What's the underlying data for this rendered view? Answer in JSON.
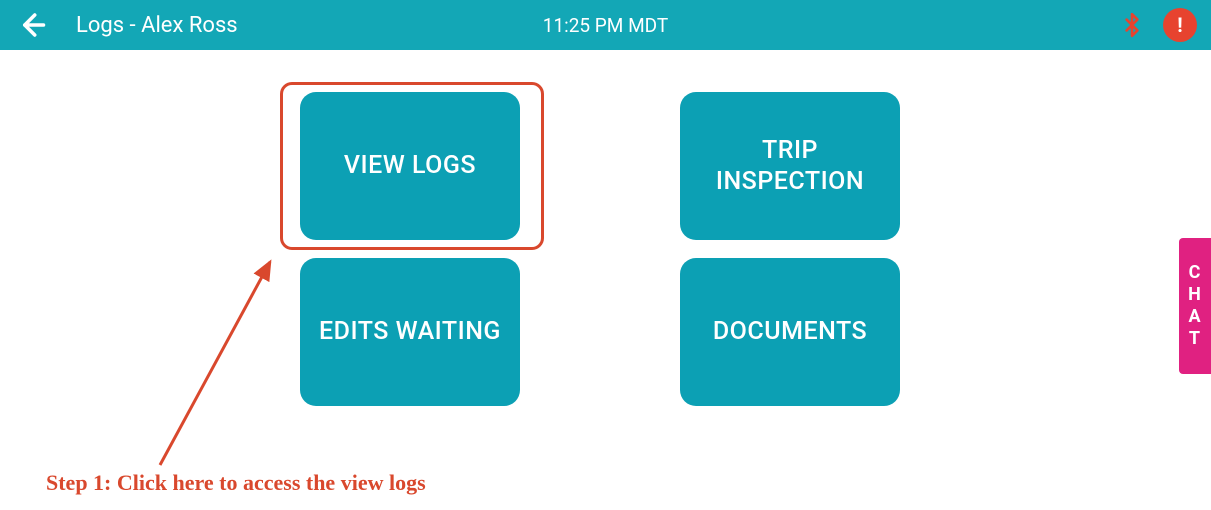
{
  "topbar": {
    "title": "Logs - Alex Ross",
    "time": "11:25 PM MDT",
    "alert_label": "!"
  },
  "tiles": {
    "view_logs": "VIEW LOGS",
    "trip_inspection": "TRIP INSPECTION",
    "edits_waiting": "EDITS WAITING",
    "documents": "DOCUMENTS"
  },
  "annotation": {
    "step_text": "Step 1: Click here to access the view logs"
  },
  "chat": {
    "c": "C",
    "h": "H",
    "a": "A",
    "t": "T"
  }
}
